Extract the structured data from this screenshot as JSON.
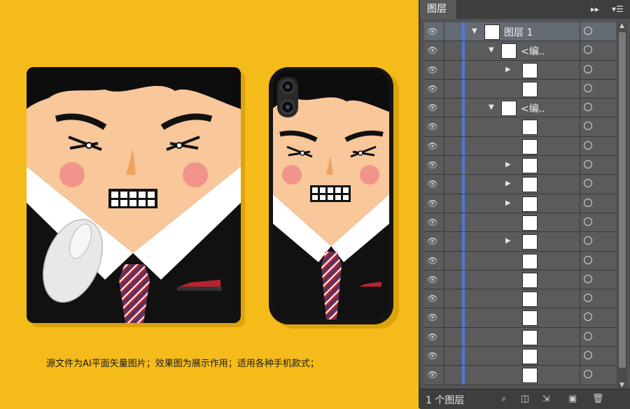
{
  "caption": "源文件为AI平面矢量图片；效果图为展示作用；适用各种手机款式；",
  "layers_panel": {
    "tab_label": "图层",
    "footer_count": "1 个图层",
    "rows": [
      {
        "name": "图层 1",
        "indent": 0,
        "expanded": true,
        "twisty": true
      },
      {
        "name": "<编..",
        "indent": 1,
        "expanded": true,
        "twisty": true
      },
      {
        "name": "",
        "indent": 2,
        "expanded": false,
        "twisty": true
      },
      {
        "name": "",
        "indent": 2,
        "twisty": false
      },
      {
        "name": "<编..",
        "indent": 1,
        "expanded": true,
        "twisty": true
      },
      {
        "name": "",
        "indent": 2,
        "twisty": false
      },
      {
        "name": "",
        "indent": 2,
        "twisty": false
      },
      {
        "name": "",
        "indent": 2,
        "expanded": false,
        "twisty": true
      },
      {
        "name": "",
        "indent": 2,
        "expanded": false,
        "twisty": true
      },
      {
        "name": "",
        "indent": 2,
        "expanded": false,
        "twisty": true
      },
      {
        "name": "",
        "indent": 2,
        "twisty": false
      },
      {
        "name": "",
        "indent": 2,
        "expanded": false,
        "twisty": true
      },
      {
        "name": "",
        "indent": 2,
        "twisty": false
      },
      {
        "name": "",
        "indent": 2,
        "twisty": false
      },
      {
        "name": "",
        "indent": 2,
        "twisty": false
      },
      {
        "name": "",
        "indent": 2,
        "twisty": false
      },
      {
        "name": "",
        "indent": 2,
        "twisty": false
      },
      {
        "name": "",
        "indent": 2,
        "twisty": false
      },
      {
        "name": "",
        "indent": 2,
        "twisty": false
      }
    ]
  },
  "colors": {
    "background": "#f5bb1a",
    "skin": "#f8c79a",
    "cheek": "#f08b88",
    "suit": "#111111",
    "tie_red": "#b8232f",
    "tie_blue": "#2c3f7b",
    "panel": "#535353",
    "layer_bar": "#4d7ad6"
  }
}
